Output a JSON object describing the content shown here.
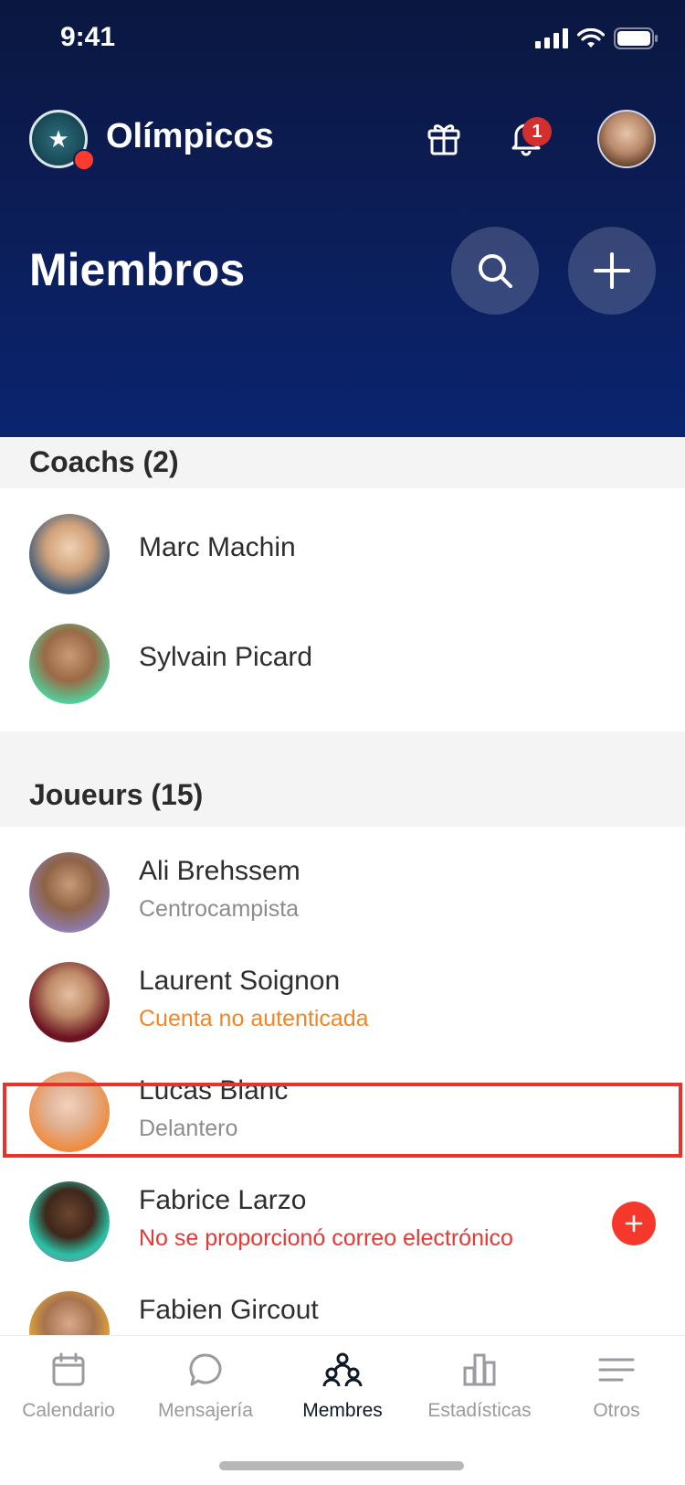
{
  "status": {
    "time": "9:41"
  },
  "header": {
    "team_name": "Olímpicos",
    "notifications_count": "1",
    "title": "Miembros"
  },
  "sections": [
    {
      "heading": "Coachs (2)",
      "members": [
        {
          "name": "Marc Machin",
          "subtitle": ""
        },
        {
          "name": "Sylvain Picard",
          "subtitle": ""
        }
      ]
    },
    {
      "heading": "Joueurs (15)",
      "members": [
        {
          "name": "Ali Brehssem",
          "subtitle": "Centrocampista"
        },
        {
          "name": "Laurent Soignon",
          "subtitle": "Cuenta no autenticada"
        },
        {
          "name": "Lucas Blanc",
          "subtitle": "Delantero"
        },
        {
          "name": "Fabrice Larzo",
          "subtitle": "No se proporcionó correo electrónico"
        },
        {
          "name": "Fabien Gircout",
          "subtitle": ""
        }
      ]
    }
  ],
  "tabs": [
    {
      "label": "Calendario",
      "icon": "calendar-icon"
    },
    {
      "label": "Mensajería",
      "icon": "chat-bubble-icon"
    },
    {
      "label": "Membres",
      "icon": "members-icon",
      "active": true
    },
    {
      "label": "Estadísticas",
      "icon": "bar-chart-icon"
    },
    {
      "label": "Otros",
      "icon": "menu-lines-icon"
    }
  ],
  "colors": {
    "header_bg": "#0c1d55",
    "warning": "#f0852a",
    "error": "#e53935",
    "badge": "#d32f2f",
    "selection_outline": "#e8332a"
  }
}
